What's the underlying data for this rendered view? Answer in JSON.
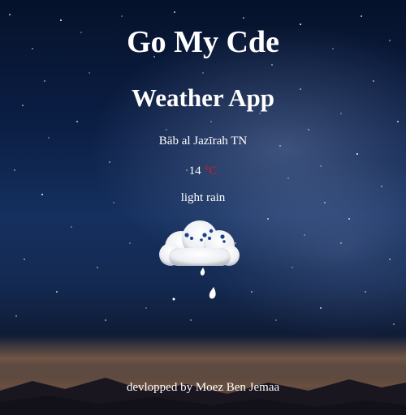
{
  "header": {
    "title": "Go My Cde",
    "subtitle": "Weather App"
  },
  "weather": {
    "city": "Bāb al Jazīrah TN",
    "temperature": "14",
    "unit": "°C",
    "description": "light rain",
    "icon": "rain-cloud-icon"
  },
  "footer": {
    "credit": "devlopped by Moez Ben Jemaa"
  },
  "colors": {
    "unit": "#e3161b",
    "text": "#ffffff"
  },
  "background": "night-sky-milky-way"
}
